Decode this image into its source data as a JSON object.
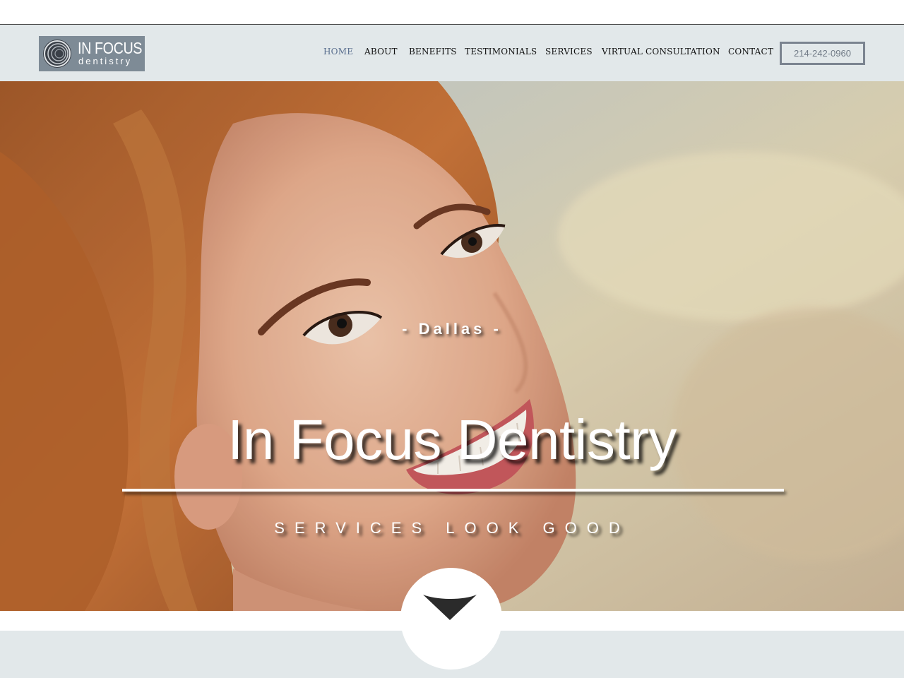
{
  "brand": {
    "line1": "IN FOCUS",
    "line2": "dentistry",
    "logo_icon": "concentric-rings-icon"
  },
  "nav": {
    "items": [
      {
        "label": "HOME",
        "active": true
      },
      {
        "label": "ABOUT",
        "active": false
      },
      {
        "label": "BENEFITS",
        "active": false
      },
      {
        "label": "TESTIMONIALS",
        "active": false
      },
      {
        "label": "SERVICES",
        "active": false
      },
      {
        "label": "VIRTUAL CONSULTATION",
        "active": false
      },
      {
        "label": "CONTACT",
        "active": false
      }
    ],
    "phone": "214-242-0960"
  },
  "hero": {
    "location": "- Dallas -",
    "title": "In Focus Dentistry",
    "tagline": "SERVICES LOOK GOOD",
    "scroll_icon": "chevron-down-icon"
  },
  "colors": {
    "header_bg": "#e2e8ea",
    "logo_bg": "#7e8b96",
    "nav_active": "#5a6f8f",
    "phone_border": "#7b8490"
  }
}
